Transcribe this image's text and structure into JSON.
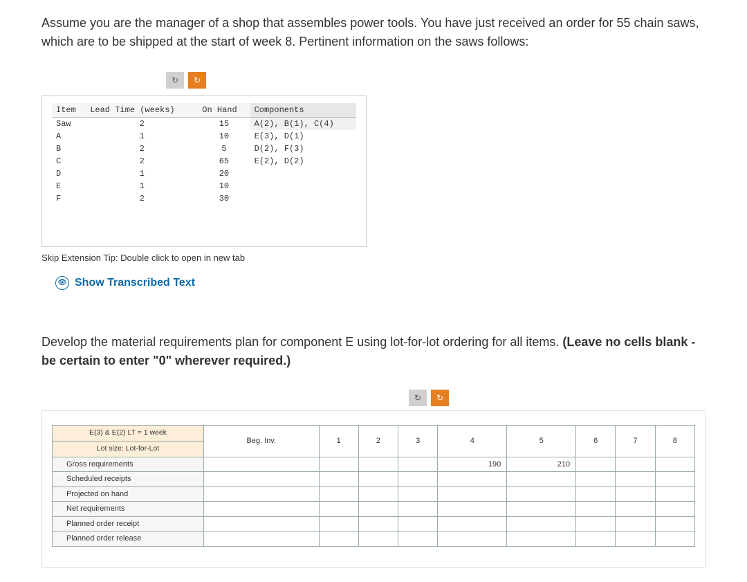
{
  "intro": "Assume you are the manager of a shop that assembles power tools. You have just received an order for 55 chain saws, which are to be shipped at the start of week 8. Pertinent information on the saws follows:",
  "bom": {
    "headers": [
      "Item",
      "Lead Time (weeks)",
      "On Hand",
      "Components"
    ],
    "rows": [
      {
        "item": "Saw",
        "lead": "2",
        "onhand": "15",
        "comp": "A(2), B(1), C(4)"
      },
      {
        "item": "A",
        "lead": "1",
        "onhand": "10",
        "comp": "E(3), D(1)"
      },
      {
        "item": "B",
        "lead": "2",
        "onhand": "5",
        "comp": "D(2), F(3)"
      },
      {
        "item": "C",
        "lead": "2",
        "onhand": "65",
        "comp": "E(2), D(2)"
      },
      {
        "item": "D",
        "lead": "1",
        "onhand": "20",
        "comp": ""
      },
      {
        "item": "E",
        "lead": "1",
        "onhand": "10",
        "comp": ""
      },
      {
        "item": "F",
        "lead": "2",
        "onhand": "30",
        "comp": ""
      }
    ]
  },
  "tip": "Skip Extension Tip: Double click to open in new tab",
  "show_transcribed": "Show Transcribed Text",
  "question2_a": "Develop the material requirements plan for component E using lot-for-lot ordering for all items. ",
  "question2_b": "(Leave no cells blank - be certain to enter \"0\" wherever required.)",
  "mrp": {
    "spec_top": "E(3) & E(2) LT = 1 week",
    "spec_bot": "Lot size: Lot-for-Lot",
    "cols": [
      "Beg. Inv.",
      "1",
      "2",
      "3",
      "4",
      "5",
      "6",
      "7",
      "8"
    ],
    "rows": [
      {
        "label": "Gross requirements",
        "vals": [
          "",
          "",
          "",
          "",
          "190",
          "210",
          "",
          "",
          ""
        ]
      },
      {
        "label": "Scheduled receipts",
        "vals": [
          "",
          "",
          "",
          "",
          "",
          "",
          "",
          "",
          ""
        ]
      },
      {
        "label": "Projected on hand",
        "vals": [
          "",
          "",
          "",
          "",
          "",
          "",
          "",
          "",
          ""
        ]
      },
      {
        "label": "Net requirements",
        "vals": [
          "",
          "",
          "",
          "",
          "",
          "",
          "",
          "",
          ""
        ]
      },
      {
        "label": "Planned order receipt",
        "vals": [
          "",
          "",
          "",
          "",
          "",
          "",
          "",
          "",
          ""
        ]
      },
      {
        "label": "Planned order release",
        "vals": [
          "",
          "",
          "",
          "",
          "",
          "",
          "",
          "",
          ""
        ]
      }
    ]
  }
}
